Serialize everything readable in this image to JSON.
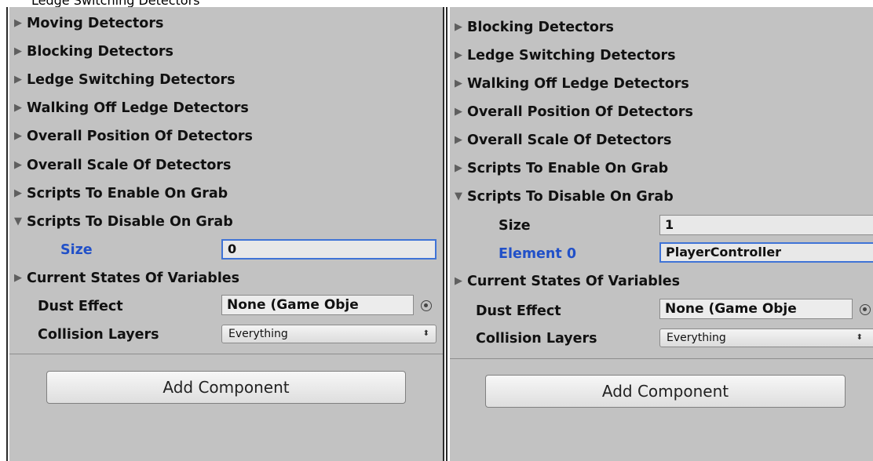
{
  "top_label": "Ledge Switching Detectors",
  "left": {
    "foldouts_collapsed": [
      "Moving Detectors",
      "Blocking Detectors",
      "Ledge Switching Detectors",
      "Walking Off Ledge Detectors",
      "Overall Position Of Detectors",
      "Overall Scale Of Detectors",
      "Scripts To Enable On Grab"
    ],
    "foldout_expanded": "Scripts To Disable On Grab",
    "size_label": "Size",
    "size_value": "0",
    "current_states": "Current States Of Variables",
    "dust_effect_label": "Dust Effect",
    "dust_effect_value": "None (Game Obje",
    "collision_label": "Collision Layers",
    "collision_value": "Everything",
    "add_component": "Add Component"
  },
  "right": {
    "foldouts_collapsed": [
      "Blocking Detectors",
      "Ledge Switching Detectors",
      "Walking Off Ledge Detectors",
      "Overall Position Of Detectors",
      "Overall Scale Of Detectors",
      "Scripts To Enable On Grab"
    ],
    "foldout_expanded": "Scripts To Disable On Grab",
    "size_label": "Size",
    "size_value": "1",
    "element0_label": "Element 0",
    "element0_value": "PlayerController",
    "current_states": "Current States Of Variables",
    "dust_effect_label": "Dust Effect",
    "dust_effect_value": "None (Game Obje",
    "collision_label": "Collision Layers",
    "collision_value": "Everything",
    "add_component": "Add Component"
  },
  "icons": {
    "collapsed_arrow": "▶",
    "expanded_arrow": "▼",
    "dropdown_arrow": "⬍"
  },
  "colors": {
    "panel_bg": "#c2c2c2",
    "focus_blue": "#3f73d6",
    "label_blue": "#2150c8"
  }
}
